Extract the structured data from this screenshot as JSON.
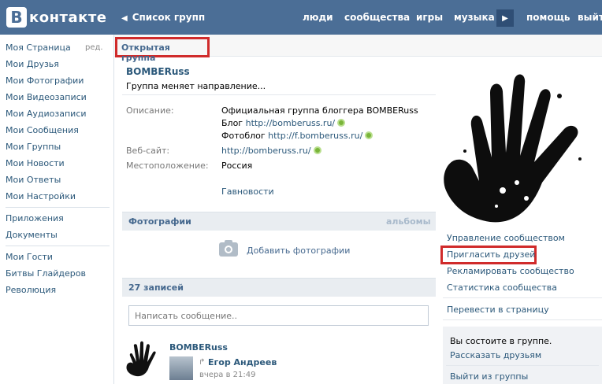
{
  "header": {
    "logo_letter": "В",
    "logo_text": "контакте",
    "back_label": "Список групп",
    "nav": [
      "люди",
      "сообщества",
      "игры",
      "музыка",
      "помощь",
      "выйти"
    ]
  },
  "leftmenu": {
    "edit_label": "ред.",
    "group1": [
      "Моя Страница",
      "Мои Друзья",
      "Мои Фотографии",
      "Мои Видеозаписи",
      "Мои Аудиозаписи",
      "Мои Сообщения",
      "Мои Группы",
      "Мои Новости",
      "Мои Ответы",
      "Мои Настройки"
    ],
    "group2": [
      "Приложения",
      "Документы"
    ],
    "group3": [
      "Мои Гости",
      "Битвы Глайдеров",
      "Революция"
    ]
  },
  "group": {
    "type": "Открытая группа",
    "name": "BOMBERuss",
    "status": "Группа меняет направление...",
    "info": {
      "description_label": "Описание:",
      "description_text": "Официальная группа блоггера BOMBERuss",
      "blog_label": "Блог",
      "blog_url": "http://bomberuss.ru/",
      "photoblog_label": "Фотоблог",
      "photoblog_url": "http://f.bomberuss.ru/",
      "website_label": "Веб-сайт:",
      "website_url": "http://bomberuss.ru/",
      "location_label": "Местоположение:",
      "location_value": "Россия",
      "news_link": "Гавновости"
    }
  },
  "photos": {
    "title": "Фотографии",
    "albums_link": "альбомы",
    "add_label": "Добавить фотографии"
  },
  "wall": {
    "count_title": "27 записей",
    "input_placeholder": "Написать сообщение..",
    "post_author": "BOMBERuss",
    "repost_name": "Егор Андреев",
    "repost_time": "вчера в 21:49"
  },
  "right": {
    "links": [
      "Управление сообществом",
      "Пригласить друзей",
      "Рекламировать сообщество",
      "Статистика сообщества"
    ],
    "to_page": "Перевести в страницу",
    "member_text": "Вы состоите в группе.",
    "tell_friends": "Рассказать друзьям",
    "leave": "Выйти из группы"
  },
  "colors": {
    "header_bg": "#4b6e96",
    "link": "#2b587a",
    "highlight_red": "#d02b2b"
  }
}
